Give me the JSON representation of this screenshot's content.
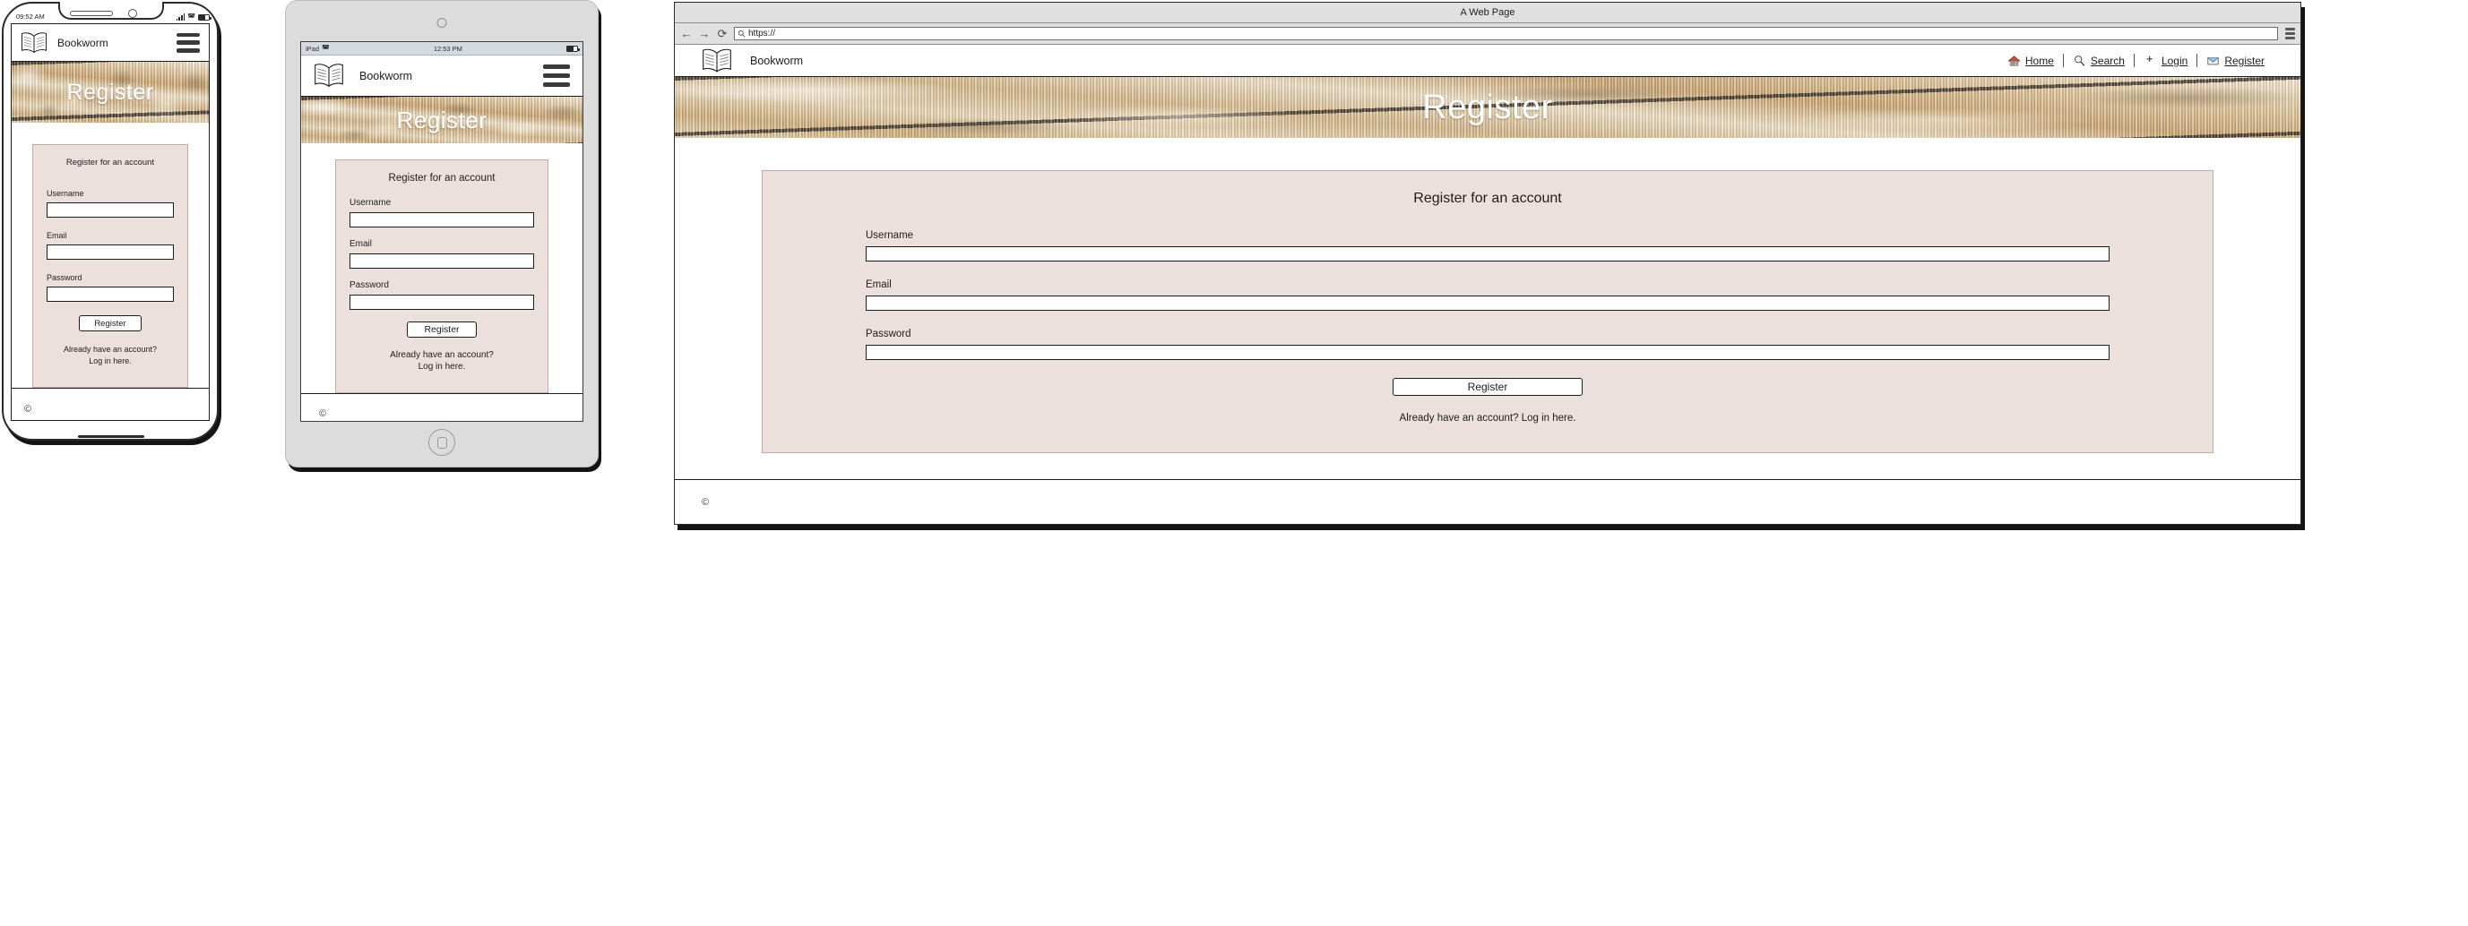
{
  "site": {
    "brand": "Bookworm",
    "hero_title": "Register",
    "footer_copyright": "©",
    "accent_card_bg": "#ece0dd",
    "accent_card_border": "#c8a8a4",
    "hero_bg": "#c9ab7d"
  },
  "form": {
    "heading": "Register for an account",
    "username_label": "Username",
    "username_value": "",
    "username_placeholder": "",
    "email_label": "Email",
    "email_value": "",
    "email_placeholder": "",
    "password_label": "Password",
    "password_value": "",
    "password_placeholder": "",
    "submit_label": "Register",
    "helper_line1": "Already have an account?",
    "helper_line2": "Log in here.",
    "helper_single": "Already have an account?  Log in here."
  },
  "phone": {
    "status_time": "09:52 AM",
    "signal_icon": "signal-bars-icon",
    "wifi_icon": "wifi-icon",
    "battery_icon": "battery-icon",
    "menu_icon": "hamburger-menu-icon",
    "logo_icon": "open-book-logo-icon"
  },
  "tablet": {
    "device_label": "iPad",
    "status_time": "12:53 PM",
    "wifi_icon": "wifi-icon",
    "battery_icon": "battery-icon",
    "menu_icon": "hamburger-menu-icon",
    "logo_icon": "open-book-logo-icon",
    "home_button_icon": "home-button-icon"
  },
  "browser": {
    "window_title": "A Web Page",
    "url_value": "https://",
    "url_placeholder": "https://",
    "back_icon": "back-arrow-icon",
    "forward_icon": "forward-arrow-icon",
    "reload_icon": "reload-icon",
    "search_icon": "search-icon",
    "menu_icon": "browser-menu-icon",
    "nav_links": [
      {
        "label": "Home",
        "icon": "house-icon"
      },
      {
        "label": "Search",
        "icon": "magnifier-icon"
      },
      {
        "label": "Login",
        "icon": "plus-icon"
      },
      {
        "label": "Register",
        "icon": "envelope-icon"
      }
    ],
    "nav_separator": "|"
  }
}
